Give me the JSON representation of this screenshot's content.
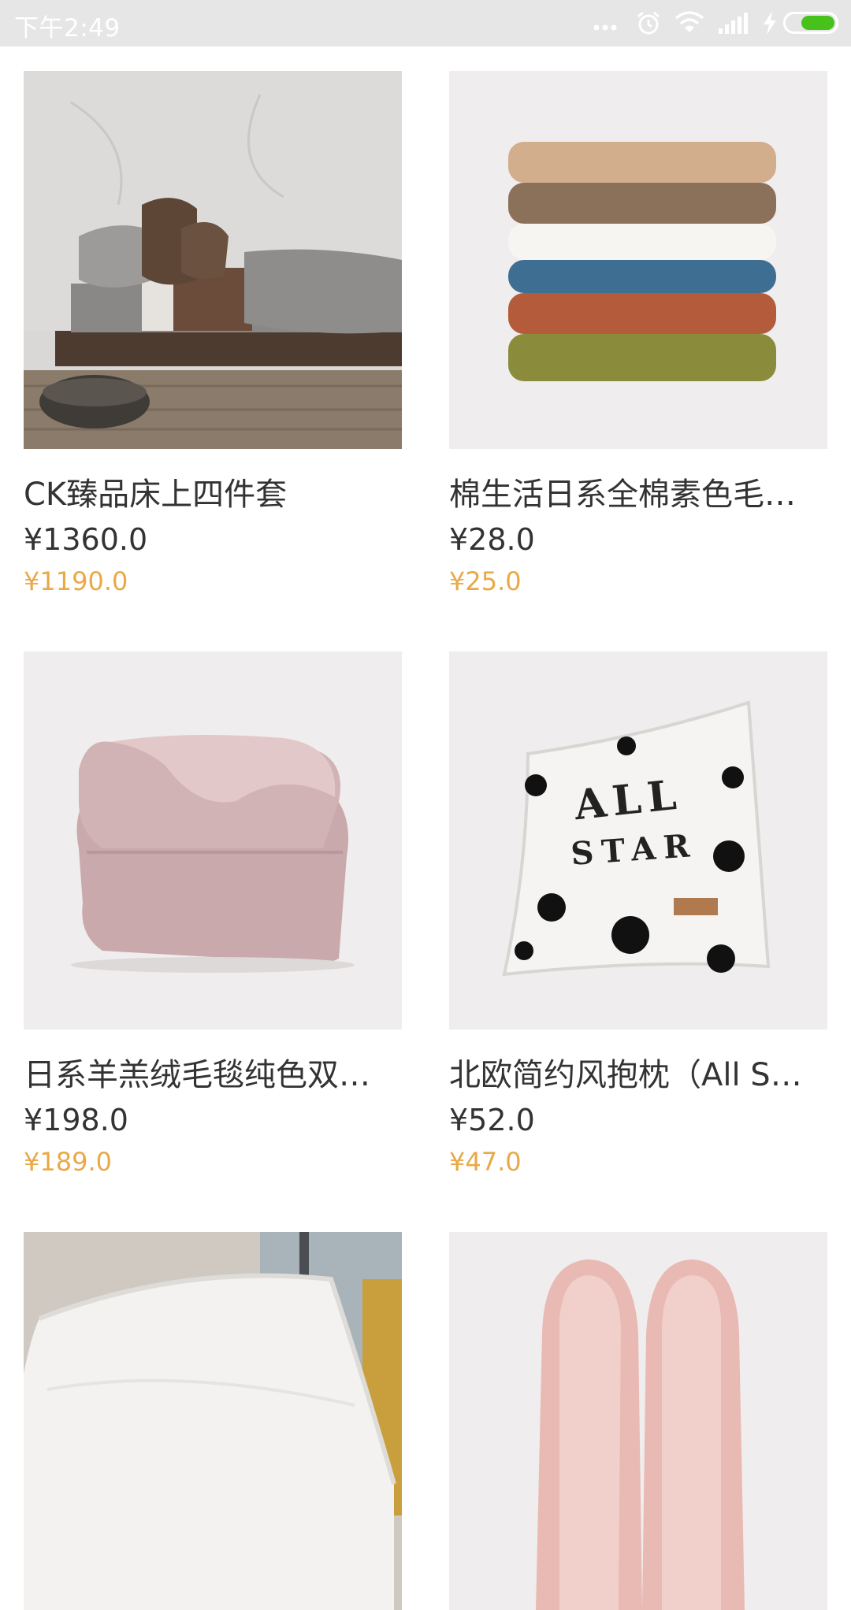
{
  "status_bar": {
    "time": "下午2:49",
    "icons": [
      "more-dots-icon",
      "alarm-icon",
      "wifi-icon",
      "signal-icon",
      "charging-icon",
      "battery-icon"
    ],
    "battery_color": "#46c21b"
  },
  "products": [
    {
      "name": "CK臻品床上四件套",
      "price": "¥1360.0",
      "sale_price": "¥1190.0",
      "image": "bedding-set"
    },
    {
      "name": "棉生活日系全棉素色毛…",
      "price": "¥28.0",
      "sale_price": "¥25.0",
      "image": "folded-towels"
    },
    {
      "name": "日系羊羔绒毛毯纯色双…",
      "price": "¥198.0",
      "sale_price": "¥189.0",
      "image": "pink-blanket"
    },
    {
      "name": "北欧简约风抱枕（All S…",
      "price": "¥52.0",
      "sale_price": "¥47.0",
      "image": "polka-dot-pillow",
      "image_text": [
        "ALL",
        "STAR"
      ]
    },
    {
      "name": "",
      "price": "",
      "sale_price": "",
      "image": "latex-pillow"
    },
    {
      "name": "",
      "price": "",
      "sale_price": "",
      "image": "pink-slippers"
    }
  ],
  "colors": {
    "price": "#333333",
    "sale_price": "#e9a946",
    "image_bg": "#efeded"
  }
}
